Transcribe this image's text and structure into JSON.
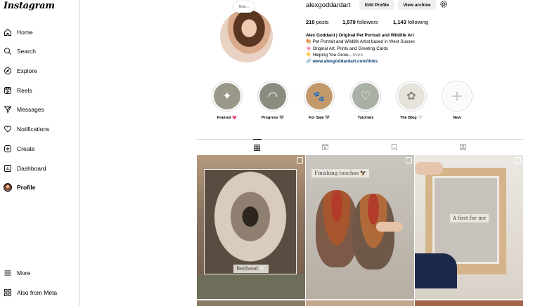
{
  "sidebar": {
    "logo": "Instagram",
    "items": [
      {
        "label": "Home",
        "icon": "home-icon"
      },
      {
        "label": "Search",
        "icon": "search-icon"
      },
      {
        "label": "Explore",
        "icon": "explore-icon"
      },
      {
        "label": "Reels",
        "icon": "reels-icon"
      },
      {
        "label": "Messages",
        "icon": "messages-icon"
      },
      {
        "label": "Notifications",
        "icon": "heart-icon"
      },
      {
        "label": "Create",
        "icon": "plus-icon"
      },
      {
        "label": "Dashboard",
        "icon": "dashboard-icon"
      },
      {
        "label": "Profile",
        "icon": "avatar"
      }
    ],
    "bottom": [
      {
        "label": "More",
        "icon": "menu-icon"
      },
      {
        "label": "Also from Meta",
        "icon": "meta-icon"
      }
    ]
  },
  "profile": {
    "note": "Note...",
    "username": "alexgoddardart",
    "edit_label": "Edit Profile",
    "archive_label": "View archive",
    "posts_count": "210",
    "posts_label": "posts",
    "followers_count": "1,579",
    "followers_label": "followers",
    "following_count": "1,143",
    "following_label": "following",
    "bio_name": "Alex Goddard | Original Pet Portrait and Wildlife Art",
    "bio_lines": [
      "🎨 Pet Portrait and Wildlife Artist based in West Sussex",
      "🌸 Original Art, Prints and Greeting Cards",
      "👇 Helping You Grow..."
    ],
    "more_label": "more",
    "link": "www.alexgoddardart.com/links"
  },
  "highlights": [
    {
      "label": "Framed 💗",
      "color": "#9a9889",
      "glyph": "✦"
    },
    {
      "label": "Progress 🩶",
      "color": "#8c8b7f",
      "glyph": "◠"
    },
    {
      "label": "For Sale 🩶",
      "color": "#c2996a",
      "glyph": "🐾"
    },
    {
      "label": "Tutorials",
      "color": "#a9b0a5",
      "glyph": "♡"
    },
    {
      "label": "The Blog 🤍",
      "color": "#e5e3dc",
      "glyph": "✿"
    },
    {
      "label": "New",
      "color": "#ffffff",
      "glyph": "+"
    }
  ],
  "posts": [
    {
      "caption": "Bedhead 🤍"
    },
    {
      "caption": "Finishing touches 🦅"
    },
    {
      "caption": "A first for me"
    }
  ]
}
